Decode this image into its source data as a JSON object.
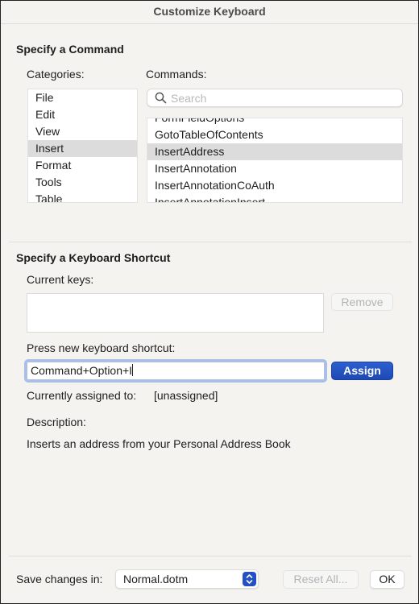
{
  "window": {
    "title": "Customize Keyboard"
  },
  "command_section": {
    "heading": "Specify a Command",
    "categories_label": "Categories:",
    "categories": [
      "File",
      "Edit",
      "View",
      "Insert",
      "Format",
      "Tools",
      "Table"
    ],
    "selected_category": "Insert",
    "commands_label": "Commands:",
    "search": {
      "placeholder": "Search",
      "value": "",
      "icon": "search-icon"
    },
    "commands": [
      "FormFieldOptions",
      "GotoTableOfContents",
      "InsertAddress",
      "InsertAnnotation",
      "InsertAnnotationCoAuth",
      "InsertAnnotationInsert"
    ],
    "selected_command": "InsertAddress"
  },
  "shortcut_section": {
    "heading": "Specify a Keyboard Shortcut",
    "current_keys_label": "Current keys:",
    "current_keys": [],
    "remove_label": "Remove",
    "press_new_label": "Press new keyboard shortcut:",
    "new_shortcut_value": "Command+Option+I",
    "assign_label": "Assign",
    "currently_assigned_label": "Currently assigned to:",
    "currently_assigned_value": "[unassigned]",
    "description_label": "Description:",
    "description_text": "Inserts an address from your Personal Address Book"
  },
  "footer": {
    "save_changes_label": "Save changes in:",
    "save_changes_value": "Normal.dotm",
    "reset_all_label": "Reset All...",
    "ok_label": "OK"
  },
  "colors": {
    "accent": "#2350c4",
    "selection": "#dcdcdc",
    "background": "#f4f3f0"
  }
}
